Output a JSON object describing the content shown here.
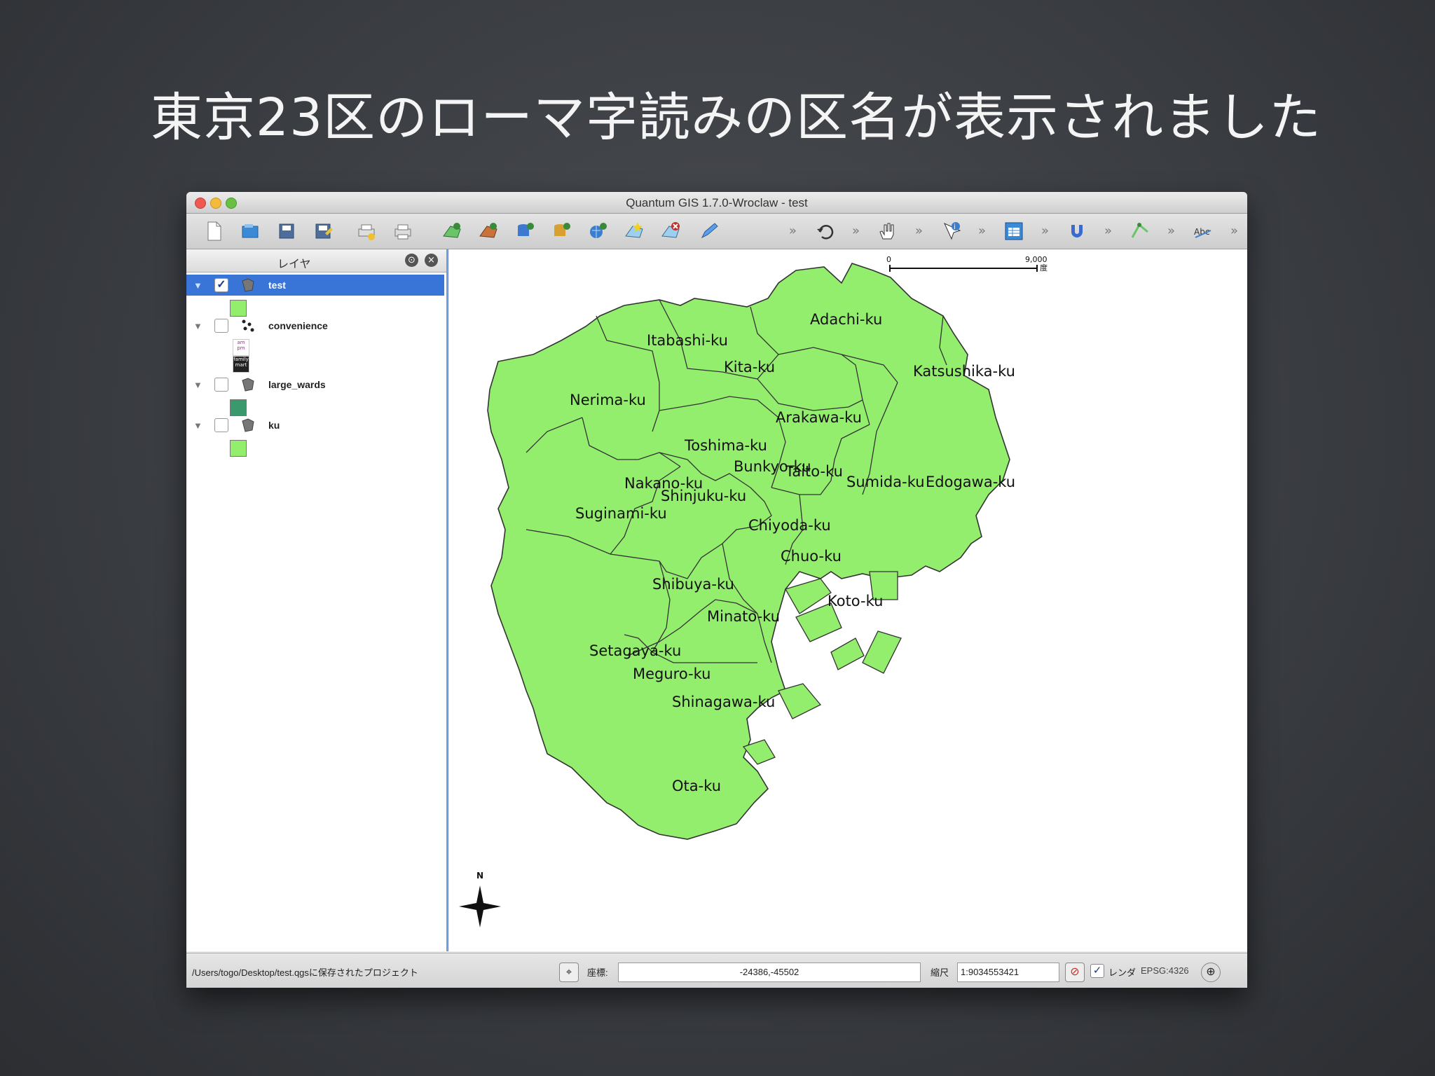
{
  "slide": {
    "title": "東京23区のローマ字読みの区名が表示されました"
  },
  "window": {
    "title": "Quantum GIS 1.7.0-Wroclaw - test"
  },
  "colors": {
    "ward_fill": "#94ee6e",
    "ward_stroke": "#333333",
    "selection": "#3875d7",
    "large_wards_fill": "#3a9a6e"
  },
  "toolbar": {
    "icons": [
      "new-project-icon",
      "open-project-icon",
      "save-project-icon",
      "save-as-icon",
      "print-composer-icon",
      "print-icon",
      "add-vector-layer-icon",
      "add-raster-layer-icon",
      "add-postgis-layer-icon",
      "add-spatialite-layer-icon",
      "add-wms-layer-icon",
      "new-shapefile-icon",
      "remove-layer-icon",
      "edit-pencil-icon",
      "undo-icon",
      "pan-icon",
      "identify-icon",
      "attribute-table-icon",
      "magnet-icon",
      "vertex-icon",
      "label-icon"
    ],
    "overflow": "»"
  },
  "layer_panel": {
    "title": "レイヤ",
    "layers": [
      {
        "name": "test",
        "checked": true,
        "selected": true,
        "icon": "polygon-layer-icon"
      },
      {
        "name": "convenience",
        "checked": false,
        "selected": false,
        "icon": "point-layer-icon"
      },
      {
        "name": "large_wards",
        "checked": false,
        "selected": false,
        "icon": "polygon-layer-icon"
      },
      {
        "name": "ku",
        "checked": false,
        "selected": false,
        "icon": "polygon-layer-icon"
      }
    ],
    "convenience_legend": [
      "am pm",
      "family mart"
    ]
  },
  "scale_bar": {
    "start": "0",
    "end": "9,000",
    "unit": "度"
  },
  "north_arrow": {
    "label": "N"
  },
  "wards": [
    "Adachi-ku",
    "Itabashi-ku",
    "Kita-ku",
    "Katsushika-ku",
    "Nerima-ku",
    "Arakawa-ku",
    "Toshima-ku",
    "Bunkyo-ku",
    "Taito-ku",
    "Nakano-ku",
    "Shinjuku-ku",
    "Sumida-ku",
    "Edogawa-ku",
    "Suginami-ku",
    "Chiyoda-ku",
    "Chuo-ku",
    "Shibuya-ku",
    "Koto-ku",
    "Minato-ku",
    "Setagaya-ku",
    "Meguro-ku",
    "Shinagawa-ku",
    "Ota-ku"
  ],
  "status_bar": {
    "message": "/Users/togo/Desktop/test.qgsに保存されたプロジェクト",
    "coord_label": "座標:",
    "coord_value": "-24386,-45502",
    "scale_label": "縮尺",
    "scale_value": "1:9034553421",
    "render_label": "レンダ",
    "crs": "EPSG:4326"
  }
}
